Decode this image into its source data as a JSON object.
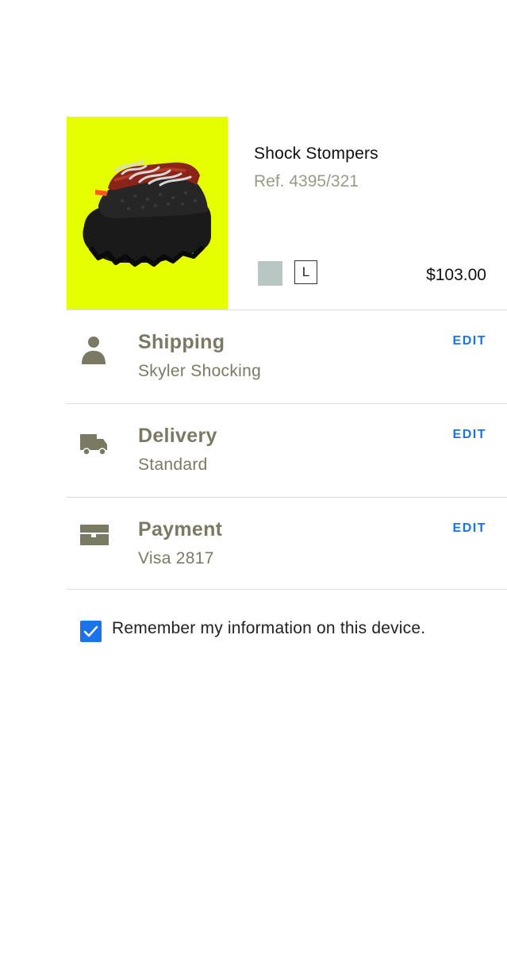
{
  "product": {
    "title": "Shock Stompers",
    "ref": "Ref. 4395/321",
    "size": "L",
    "price": "$103.00",
    "image": "black-red-platform-sneaker",
    "swatch_color": "#b8c7c3",
    "image_background": "#e6ff00"
  },
  "rows": {
    "shipping": {
      "title": "Shipping",
      "value": "Skyler Shocking",
      "edit": "EDIT",
      "icon": "person-icon"
    },
    "delivery": {
      "title": "Delivery",
      "value": "Standard",
      "edit": "EDIT",
      "icon": "truck-icon"
    },
    "payment": {
      "title": "Payment",
      "value": "Visa 2817",
      "edit": "EDIT",
      "icon": "card-icon"
    }
  },
  "remember": {
    "label": "Remember my information on this device.",
    "checked": true
  },
  "colors": {
    "accent": "#1a73e8",
    "muted_text": "#7a7a64",
    "divider": "#dddddd"
  }
}
